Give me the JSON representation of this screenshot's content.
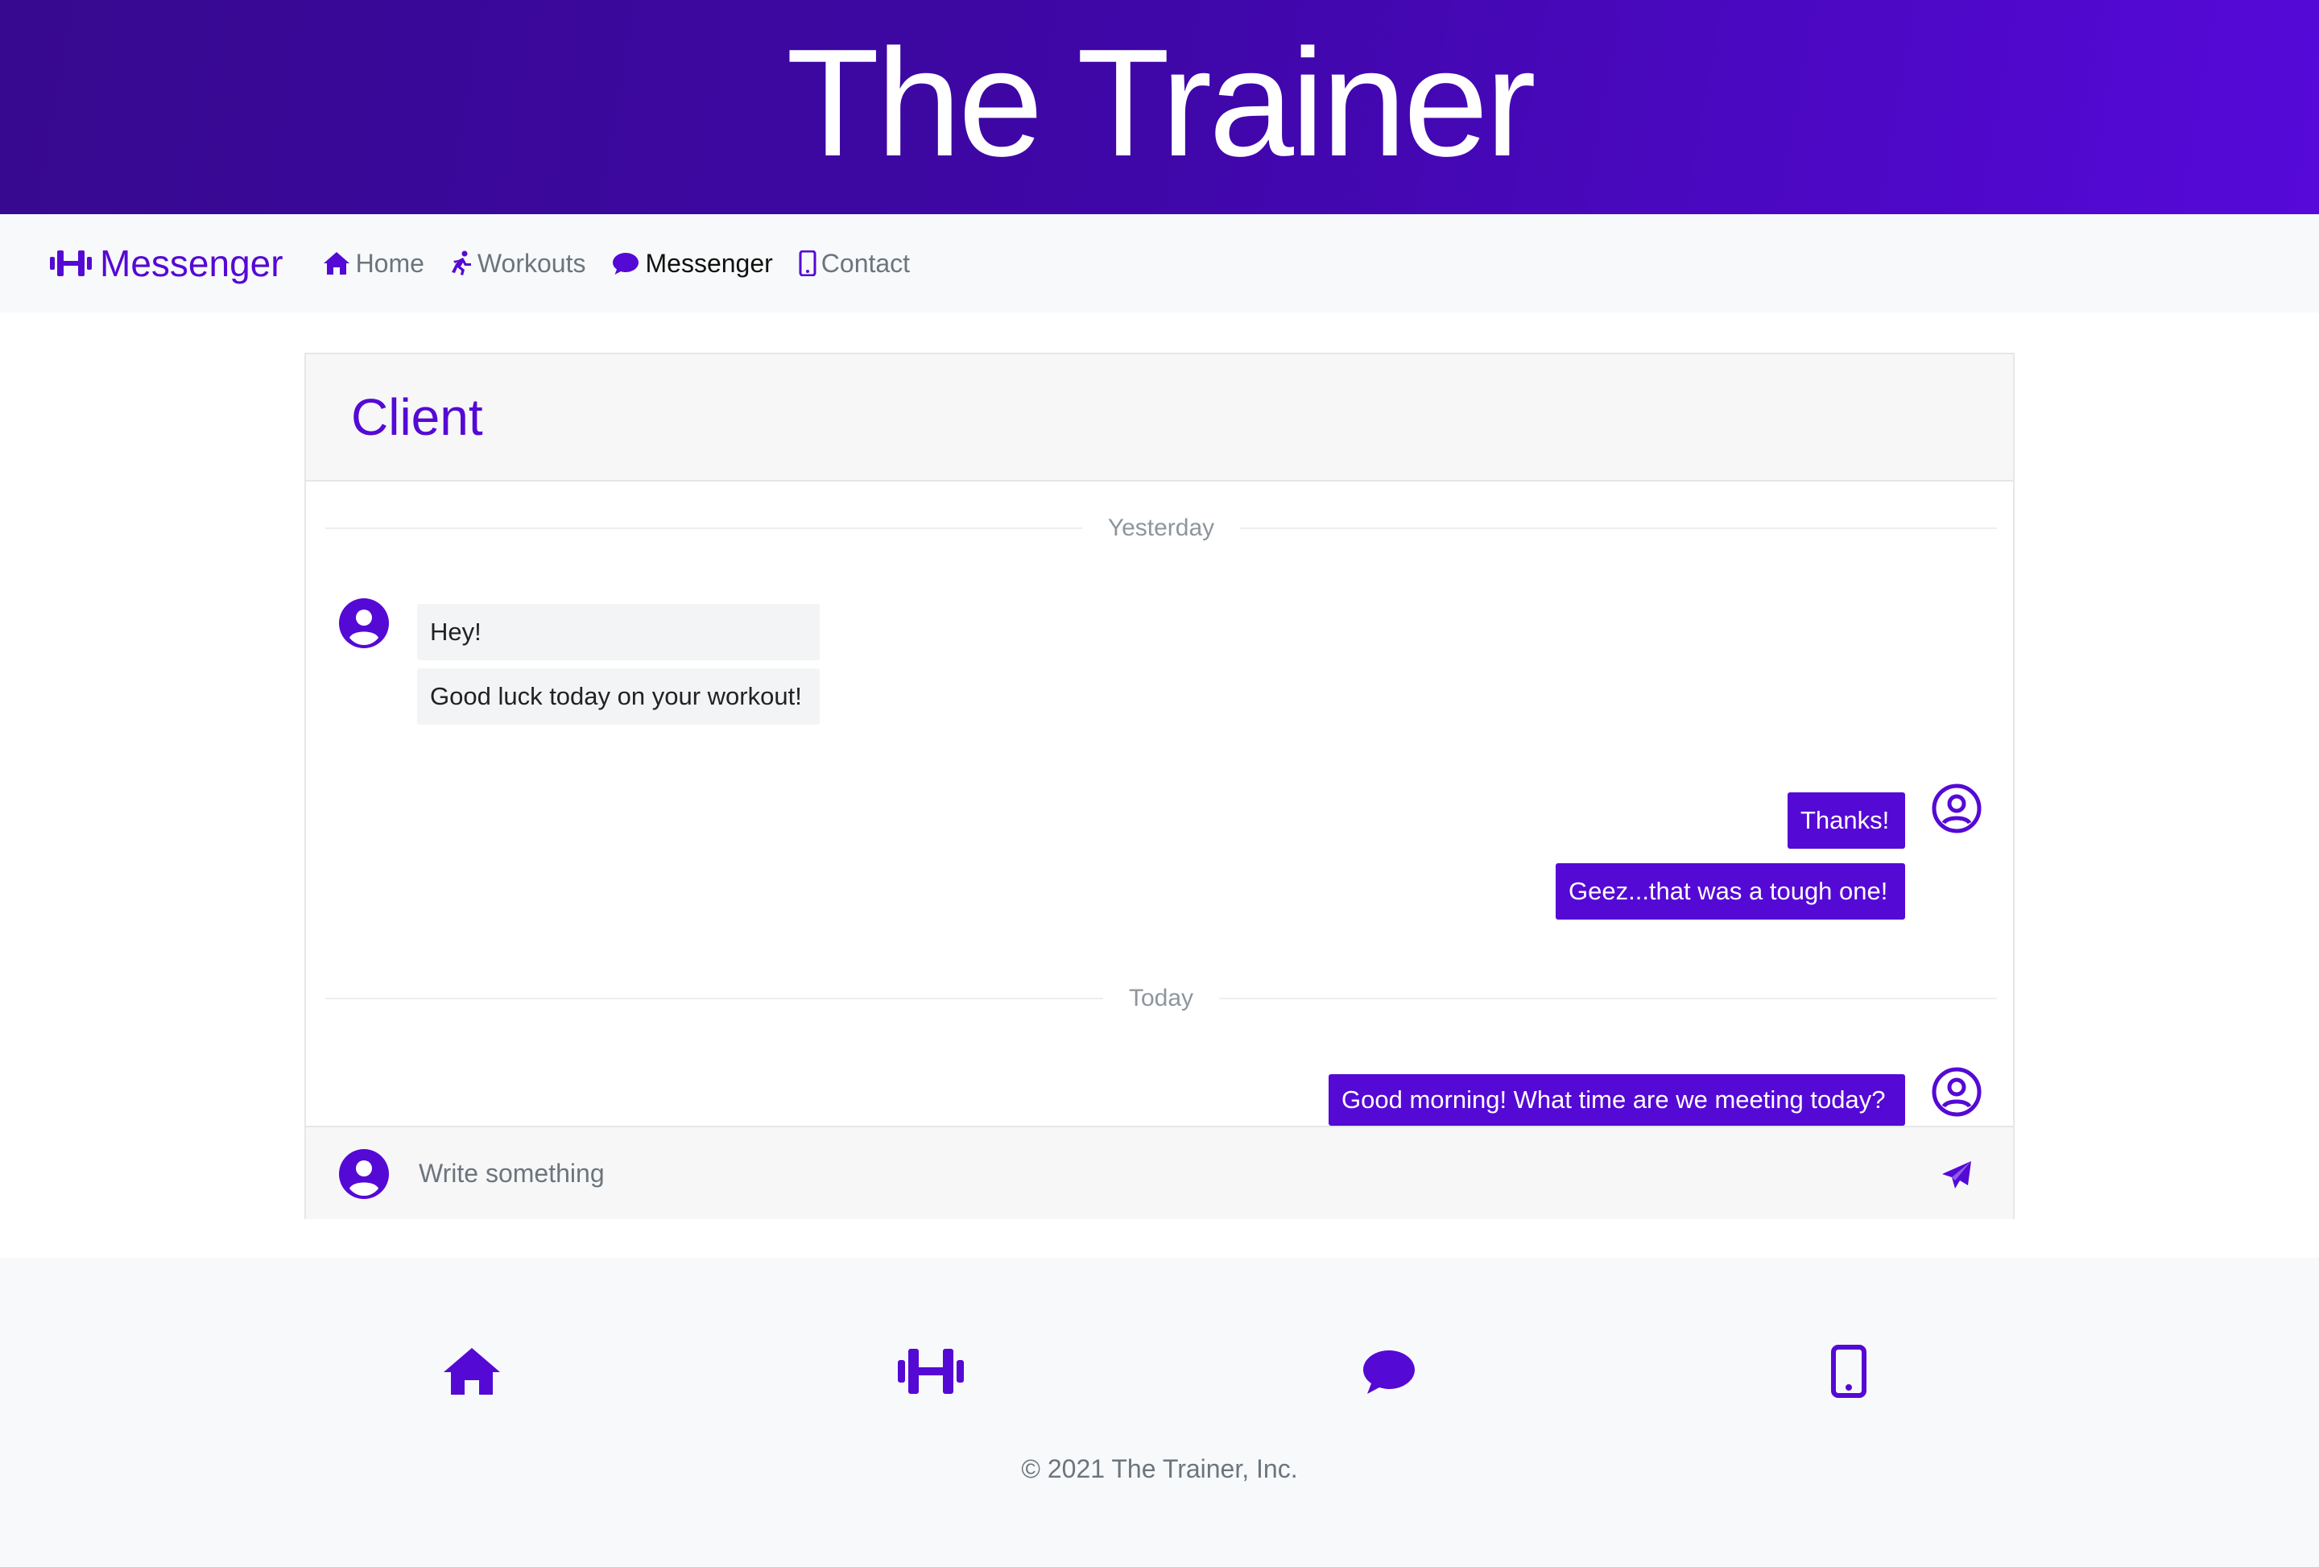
{
  "hero": {
    "title": "The Trainer"
  },
  "navbar": {
    "brand": "Messenger",
    "items": [
      {
        "label": "Home",
        "icon": "home-icon"
      },
      {
        "label": "Workouts",
        "icon": "running-icon"
      },
      {
        "label": "Messenger",
        "icon": "comment-icon",
        "active": true
      },
      {
        "label": "Contact",
        "icon": "mobile-icon"
      }
    ]
  },
  "chat": {
    "header": "Client",
    "dividers": [
      "Yesterday",
      "Today"
    ],
    "messages": [
      {
        "side": "in",
        "text": "Hey!"
      },
      {
        "side": "in",
        "text": "Good luck today on your workout!"
      },
      {
        "side": "out",
        "text": "Thanks!"
      },
      {
        "side": "out",
        "text": "Geez...that was a tough one!"
      },
      {
        "side": "out",
        "text": "Good morning! What time are we meeting today?"
      }
    ],
    "composer": {
      "placeholder": "Write something"
    }
  },
  "footer": {
    "icons": [
      "home-icon",
      "dumbbell-icon",
      "comment-icon",
      "mobile-icon"
    ],
    "copyright": "© 2021 The Trainer, Inc."
  },
  "colors": {
    "accent": "#5509d5",
    "hero_start": "#37098f",
    "hero_end": "#5609d9"
  }
}
